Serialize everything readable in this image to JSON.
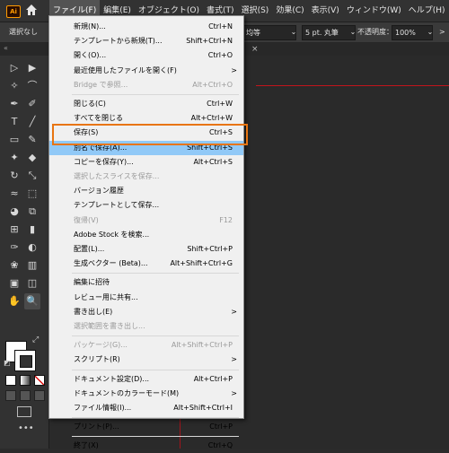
{
  "app": {
    "logo_text": "Ai"
  },
  "menubar": {
    "items": [
      "ファイル(F)",
      "編集(E)",
      "オブジェクト(O)",
      "書式(T)",
      "選択(S)",
      "効果(C)",
      "表示(V)",
      "ウィンドウ(W)",
      "ヘルプ(H)"
    ],
    "active_index": 0
  },
  "controlbar": {
    "selection_status": "選択なし",
    "stroke_profile": "均等",
    "brush": "5 pt. 丸筆",
    "opacity_label": "不透明度：",
    "opacity_value": "100%",
    "chevron": "⌄",
    "more": ">"
  },
  "tabstrip": {
    "collapse": "«",
    "close": "×"
  },
  "toolbar": {
    "tools": [
      "selection-tool",
      "direct-selection-tool",
      "magic-wand-tool",
      "lasso-tool",
      "pen-tool",
      "curvature-tool",
      "type-tool",
      "line-tool",
      "rectangle-tool",
      "paintbrush-tool",
      "shaper-tool",
      "eraser-tool",
      "rotate-tool",
      "scale-tool",
      "width-tool",
      "free-transform-tool",
      "shape-builder-tool",
      "perspective-grid-tool",
      "mesh-tool",
      "gradient-tool",
      "eyedropper-tool",
      "blend-tool",
      "symbol-sprayer-tool",
      "column-graph-tool",
      "artboard-tool",
      "slice-tool",
      "hand-tool",
      "zoom-tool"
    ],
    "tool_glyphs": [
      "▷",
      "▶",
      "✧",
      "⌒",
      "✒",
      "✐",
      "T",
      "╱",
      "▭",
      "✎",
      "✦",
      "◆",
      "↻",
      "⤡",
      "≈",
      "⬚",
      "◕",
      "⧉",
      "⊞",
      "▮",
      "✑",
      "◐",
      "❀",
      "▥",
      "▣",
      "◫",
      "✋",
      "🔍"
    ],
    "selected_tool_index": 27
  },
  "file_menu": {
    "groups": [
      [
        {
          "label": "新規(N)...",
          "shortcut": "Ctrl+N"
        },
        {
          "label": "テンプレートから新規(T)...",
          "shortcut": "Shift+Ctrl+N"
        },
        {
          "label": "開く(O)...",
          "shortcut": "Ctrl+O"
        },
        {
          "label": "最近使用したファイルを開く(F)",
          "submenu": true
        },
        {
          "label": "Bridge で参照...",
          "shortcut": "Alt+Ctrl+O",
          "disabled": true
        }
      ],
      [
        {
          "label": "閉じる(C)",
          "shortcut": "Ctrl+W"
        },
        {
          "label": "すべてを閉じる",
          "shortcut": "Alt+Ctrl+W"
        },
        {
          "label": "保存(S)",
          "shortcut": "Ctrl+S"
        },
        {
          "label": "別名で保存(A)...",
          "shortcut": "Shift+Ctrl+S",
          "highlighted": true
        },
        {
          "label": "コピーを保存(Y)...",
          "shortcut": "Alt+Ctrl+S"
        },
        {
          "label": "選択したスライスを保存...",
          "disabled": true
        },
        {
          "label": "バージョン履歴"
        },
        {
          "label": "テンプレートとして保存..."
        },
        {
          "label": "復帰(V)",
          "shortcut": "F12",
          "disabled": true
        },
        {
          "label": "Adobe Stock を検索..."
        },
        {
          "label": "配置(L)...",
          "shortcut": "Shift+Ctrl+P"
        },
        {
          "label": "生成ベクター (Beta)...",
          "shortcut": "Alt+Shift+Ctrl+G"
        }
      ],
      [
        {
          "label": "編集に招待"
        },
        {
          "label": "レビュー用に共有..."
        },
        {
          "label": "書き出し(E)",
          "submenu": true
        },
        {
          "label": "選択範囲を書き出し...",
          "disabled": true
        }
      ],
      [
        {
          "label": "パッケージ(G)...",
          "shortcut": "Alt+Shift+Ctrl+P",
          "disabled": true
        },
        {
          "label": "スクリプト(R)",
          "submenu": true
        }
      ],
      [
        {
          "label": "ドキュメント設定(D)...",
          "shortcut": "Alt+Ctrl+P"
        },
        {
          "label": "ドキュメントのカラーモード(M)",
          "submenu": true
        },
        {
          "label": "ファイル情報(I)...",
          "shortcut": "Alt+Shift+Ctrl+I"
        }
      ],
      [
        {
          "label": "プリント(P)...",
          "shortcut": "Ctrl+P"
        }
      ],
      [
        {
          "label": "終了(X)",
          "shortcut": "Ctrl+Q"
        }
      ]
    ],
    "submenu_arrow": ">"
  },
  "colors": {
    "highlight": "#91c9f7",
    "focus_outline": "#e87511",
    "artboard_edge": "#c2141c",
    "panel_bg": "#323232",
    "canvas_bg": "#2a2a2a"
  },
  "icons": {
    "home": "home-icon",
    "swap": "⤢",
    "default_colors": "◩",
    "more_tools": "•••"
  }
}
